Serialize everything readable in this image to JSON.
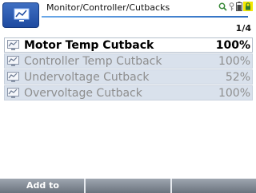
{
  "header": {
    "title": "Monitor/Controller/Cutbacks",
    "page_indicator": "1/4",
    "home_icon": "monitor-icon",
    "status_icons": [
      "search-icon",
      "key-icon",
      "battery-icon",
      "lock-icon"
    ],
    "accent_color": "#2d6cc0"
  },
  "list": {
    "items": [
      {
        "label": "Motor Temp Cutback",
        "value": "100%",
        "selected": true
      },
      {
        "label": "Controller Temp Cutback",
        "value": "100%",
        "selected": false
      },
      {
        "label": "Undervoltage Cutback",
        "value": "52%",
        "selected": false
      },
      {
        "label": "Overvoltage Cutback",
        "value": "100%",
        "selected": false
      }
    ]
  },
  "softkeys": [
    "Add to",
    "",
    ""
  ]
}
